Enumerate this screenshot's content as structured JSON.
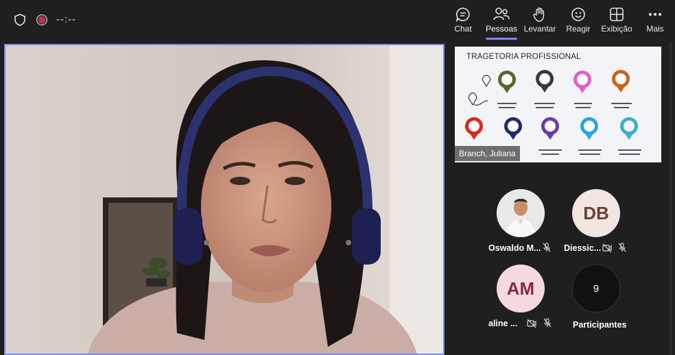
{
  "meeting": {
    "timer": "--:--"
  },
  "toolbar": {
    "items": [
      {
        "label": "Chat",
        "icon": "chat-icon"
      },
      {
        "label": "Pessoas",
        "icon": "people-icon"
      },
      {
        "label": "Levantar",
        "icon": "raise-hand-icon"
      },
      {
        "label": "Reagir",
        "icon": "react-icon"
      },
      {
        "label": "Exibição",
        "icon": "view-icon"
      },
      {
        "label": "Mais",
        "icon": "more-icon"
      }
    ],
    "active": "Pessoas",
    "accent": "#7f85f5"
  },
  "share": {
    "title": "TRAGETORIA PROFISSIONAL",
    "presenter": "Branch, Juliana"
  },
  "participants": [
    {
      "name": "Oswaldo M...",
      "avatar_type": "photo",
      "mic": "off"
    },
    {
      "name": "Diessic...",
      "initials": "DB",
      "avatar_color": "#f1e6e2",
      "text_color": "#6b3f34",
      "mic": "off",
      "camera": "off"
    },
    {
      "name": "aline ...",
      "initials": "AM",
      "avatar_color": "#f6d9e0",
      "text_color": "#8b2a3f",
      "mic": "off",
      "camera": "off"
    },
    {
      "name": "Participantes",
      "count": "9"
    }
  ],
  "colors": {
    "background": "#1f1f1f",
    "recording": "#c4314b"
  }
}
